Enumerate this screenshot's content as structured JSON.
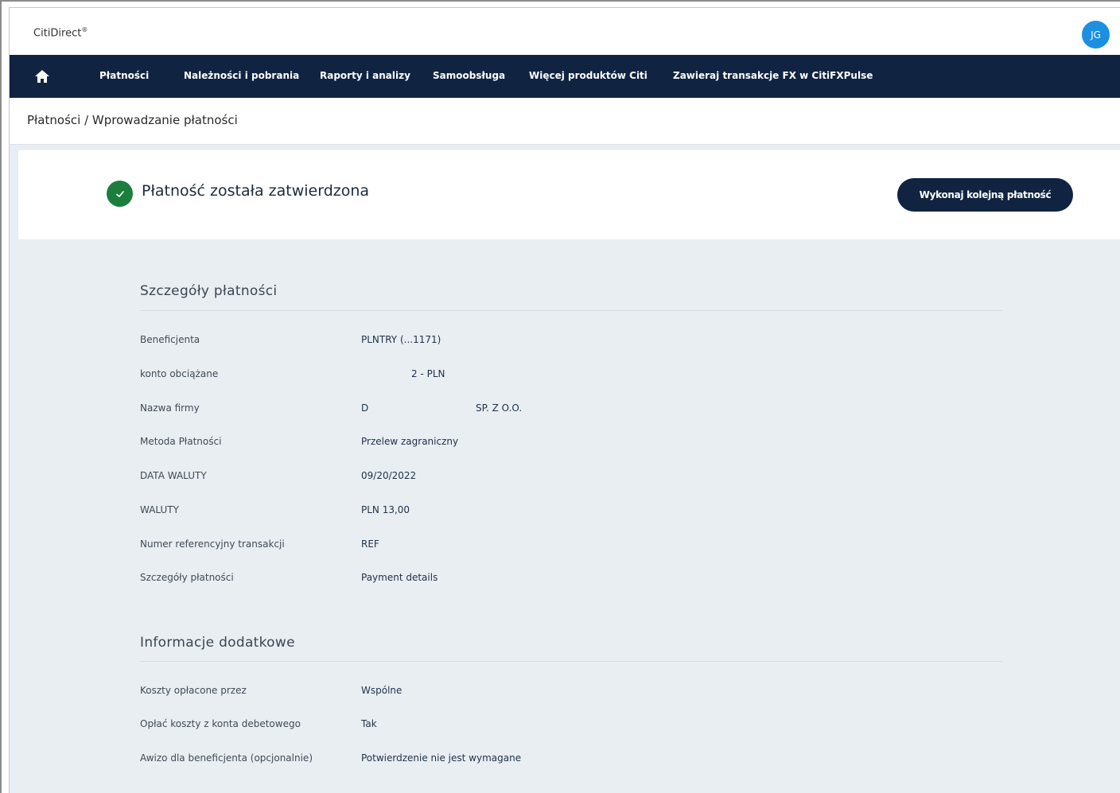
{
  "app": {
    "brand": "CitiDirect",
    "brand_mark": "®",
    "user_initials": "JG"
  },
  "nav": {
    "home_icon": "home-icon",
    "items": [
      {
        "label": "Płatności"
      },
      {
        "label": "Należności i pobrania"
      },
      {
        "label": "Raporty i analizy"
      },
      {
        "label": "Samoobsługa"
      },
      {
        "label": "Więcej produktów Citi"
      },
      {
        "label": "Zawieraj transakcje FX w CitiFXPulse"
      }
    ]
  },
  "breadcrumb": "Płatności / Wprowadzanie płatności",
  "confirmation": {
    "title": "Płatność została zatwierdzona",
    "icon": "check-circle-icon",
    "action_label": "Wykonaj kolejną płatność"
  },
  "payment_details": {
    "heading": "Szczegóły płatności",
    "rows": [
      {
        "label": "Beneficjenta",
        "value": "PLNTRY (...1171)"
      },
      {
        "label": "konto obciążane",
        "value": "2 - PLN"
      },
      {
        "label": "Nazwa firmy",
        "value": "D",
        "value_extra": "SP. Z O.O."
      },
      {
        "label": "Metoda Płatności",
        "value": "Przelew zagraniczny"
      },
      {
        "label": "DATA WALUTY",
        "value": "09/20/2022"
      },
      {
        "label": "WALUTY",
        "value": "PLN 13,00"
      },
      {
        "label": "Numer referencyjny transakcji",
        "value": "REF"
      },
      {
        "label": "Szczegóły płatności",
        "value": "Payment details"
      }
    ]
  },
  "additional_info": {
    "heading": "Informacje dodatkowe",
    "rows": [
      {
        "label": "Koszty opłacone przez",
        "value": "Wspólne"
      },
      {
        "label": "Opłać koszty z konta debetowego",
        "value": "Tak"
      },
      {
        "label": "Awizo dla beneficjenta (opcjonalnie)",
        "value": "Potwierdzenie nie jest wymagane"
      }
    ]
  },
  "colors": {
    "nav_bg": "#102442",
    "success_green": "#1c7e3d",
    "avatar_blue": "#1b8fe0",
    "page_bg": "#e9eef3"
  }
}
